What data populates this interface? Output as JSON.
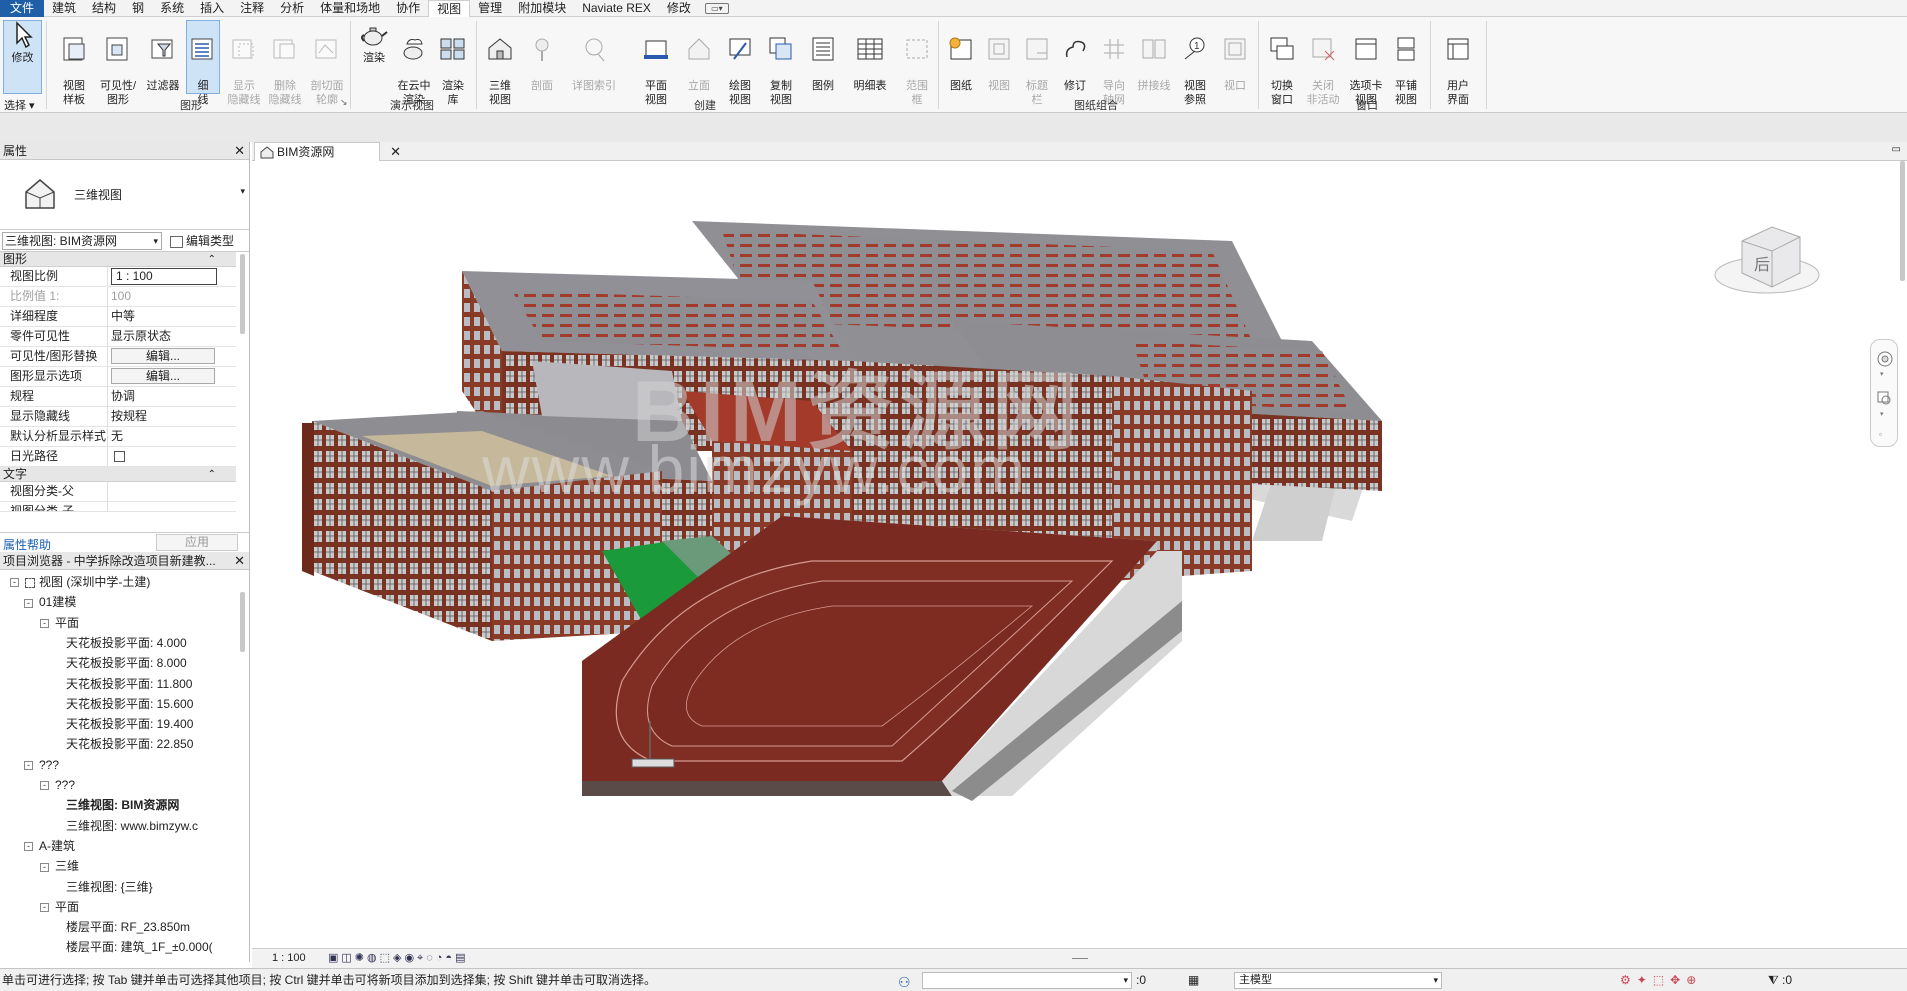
{
  "menu_tabs": [
    "文件",
    "建筑",
    "结构",
    "钢",
    "系统",
    "插入",
    "注释",
    "分析",
    "体量和场地",
    "协作",
    "视图",
    "管理",
    "附加模块",
    "Naviate REX",
    "修改"
  ],
  "active_tab": "视图",
  "ribbon": {
    "modify": "修改",
    "select": "选择 ▾",
    "graphics_buttons": [
      "视图\n样板",
      "可见性/\n图形",
      "过滤器",
      "细\n线",
      "显示\n隐藏线",
      "删除\n隐藏线",
      "剖切面\n轮廓"
    ],
    "graphics_label": "图形",
    "presentation_buttons": [
      "渲染",
      "在云中\n渲染",
      "渲染\n库"
    ],
    "presentation_label": "演示视图",
    "create_buttons": [
      "三维\n视图",
      "剖面",
      "详图索引",
      "平面\n视图",
      "立面",
      "绘图\n视图",
      "复制\n视图",
      "图例",
      "明细表",
      "范围\n框"
    ],
    "create_label": "创建",
    "sheet_buttons": [
      "图纸",
      "视图",
      "标题\n栏",
      "修订",
      "导向\n轴网",
      "拼接线",
      "视图\n参照",
      "视口"
    ],
    "sheet_label": "图纸组合",
    "window_buttons": [
      "切换\n窗口",
      "关闭\n非活动",
      "选项卡\n视图",
      "平铺\n视图"
    ],
    "window_label": "窗口",
    "ui_button": "用户\n界面"
  },
  "properties": {
    "title": "属性",
    "type_name": "三维视图",
    "instance": "三维视图: BIM资源网",
    "edit_type": "编辑类型",
    "section_graphics": "图形",
    "rows": [
      {
        "k": "视图比例",
        "v": "1 : 100",
        "kind": "input"
      },
      {
        "k": "比例值 1:",
        "v": "100",
        "kind": "disabled"
      },
      {
        "k": "详细程度",
        "v": "中等"
      },
      {
        "k": "零件可见性",
        "v": "显示原状态"
      },
      {
        "k": "可见性/图形替换",
        "v": "编辑...",
        "kind": "button"
      },
      {
        "k": "图形显示选项",
        "v": "编辑...",
        "kind": "button"
      },
      {
        "k": "规程",
        "v": "协调"
      },
      {
        "k": "显示隐藏线",
        "v": "按规程"
      },
      {
        "k": "默认分析显示样式",
        "v": "无"
      },
      {
        "k": "日光路径",
        "v": "",
        "kind": "checkbox"
      }
    ],
    "section_text": "文字",
    "text_rows": [
      {
        "k": "视图分类-父",
        "v": ""
      },
      {
        "k": "视图分类-子",
        "v": ""
      }
    ],
    "help_link": "属性帮助",
    "apply": "应用"
  },
  "browser": {
    "title": "项目浏览器 - 中学拆除改造项目新建教...",
    "nodes": [
      {
        "label": "视图 (深圳中学-土建)",
        "level": 0,
        "box": "-"
      },
      {
        "label": "01建模",
        "level": 1,
        "box": "-"
      },
      {
        "label": "平面",
        "level": 2,
        "box": "-"
      },
      {
        "label": "天花板投影平面: 4.000",
        "level": 3
      },
      {
        "label": "天花板投影平面: 8.000",
        "level": 3
      },
      {
        "label": "天花板投影平面: 11.800",
        "level": 3
      },
      {
        "label": "天花板投影平面: 15.600",
        "level": 3
      },
      {
        "label": "天花板投影平面: 19.400",
        "level": 3
      },
      {
        "label": "天花板投影平面: 22.850",
        "level": 3
      },
      {
        "label": "???",
        "level": 1,
        "box": "-"
      },
      {
        "label": "???",
        "level": 2,
        "box": "-"
      },
      {
        "label": "三维视图: BIM资源网",
        "level": 3,
        "bold": true
      },
      {
        "label": "三维视图: www.bimzyw.c",
        "level": 3
      },
      {
        "label": "A-建筑",
        "level": 1,
        "box": "-"
      },
      {
        "label": "三维",
        "level": 2,
        "box": "-"
      },
      {
        "label": "三维视图: {三维}",
        "level": 3
      },
      {
        "label": "平面",
        "level": 2,
        "box": "-"
      },
      {
        "label": "楼层平面: RF_23.850m",
        "level": 3
      },
      {
        "label": "楼层平面: 建筑_1F_±0.000(",
        "level": 3
      }
    ]
  },
  "view_tab": "BIM资源网",
  "viewcube_face": "后",
  "watermark": {
    "cn": "BIM资源网",
    "url": "www.bimzyw.com"
  },
  "view_control": {
    "scale": "1 : 100"
  },
  "status": {
    "hint": "单击可进行选择; 按 Tab 键并单击可选择其他项目; 按 Ctrl 键并单击可将新项目添加到选择集; 按 Shift 键并单击可取消选择。",
    "workset_count": ":0",
    "model": "主模型",
    "filter_count": ":0"
  }
}
